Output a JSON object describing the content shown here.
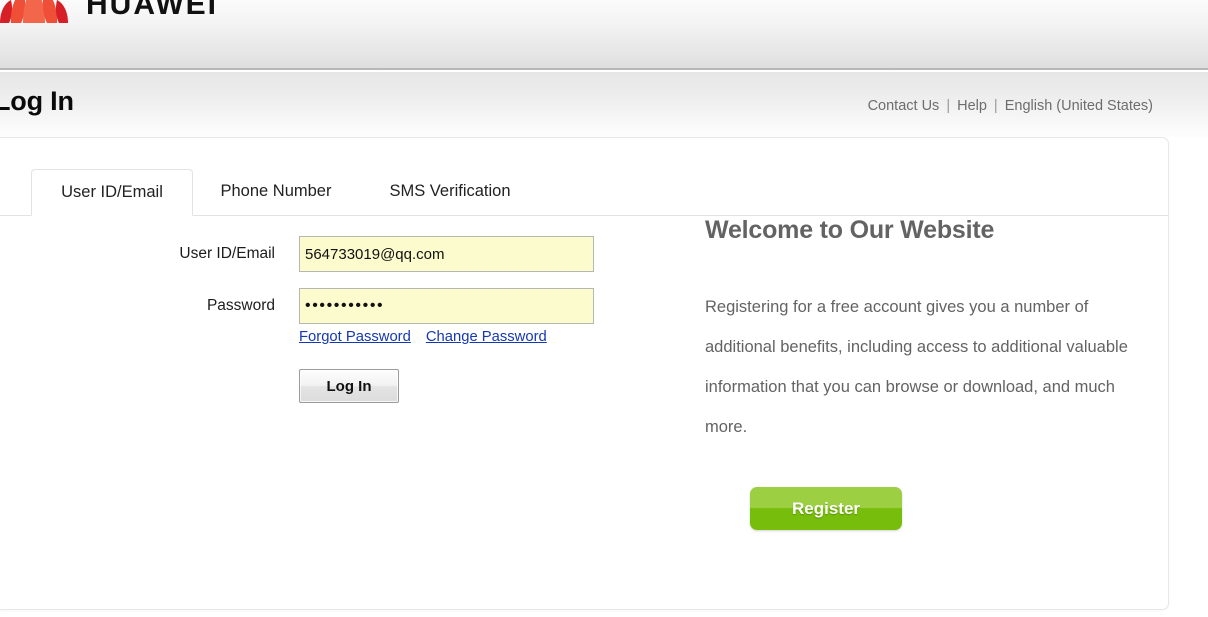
{
  "brand": {
    "logo_icon": "huawei-petal-logo",
    "name": "HUAWEI"
  },
  "header": {
    "page_title": "Log In",
    "utility_links": [
      {
        "label": "Contact Us"
      },
      {
        "label": "Help"
      },
      {
        "label": "English (United States)"
      }
    ],
    "separator": "|"
  },
  "tabs": [
    {
      "label": "User ID/Email",
      "active": true
    },
    {
      "label": "Phone Number",
      "active": false
    },
    {
      "label": "SMS Verification",
      "active": false
    }
  ],
  "form": {
    "fields": [
      {
        "label": "User ID/Email",
        "value": "564733019@qq.com",
        "placeholder": "",
        "type": "text"
      },
      {
        "label": "Password",
        "value": "•••••••••••",
        "placeholder": "",
        "type": "password"
      }
    ],
    "links": [
      {
        "label": "Forgot Password"
      },
      {
        "label": "Change Password"
      }
    ],
    "submit_label": "Log In"
  },
  "promo": {
    "title": "Welcome to Our Website",
    "body": "Registering for a free account gives you a number of additional benefits, including access to additional valuable information that you can browse or download, and much more.",
    "register_label": "Register"
  },
  "colors": {
    "brand_red": "#d80c18",
    "brand_orange": "#f05a28",
    "link_blue": "#1538b3",
    "register_green_top": "#9ccf42",
    "register_green_bottom": "#77bd0b",
    "promo_gray": "#636363",
    "input_autofill_yellow": "#fbfbcd"
  }
}
